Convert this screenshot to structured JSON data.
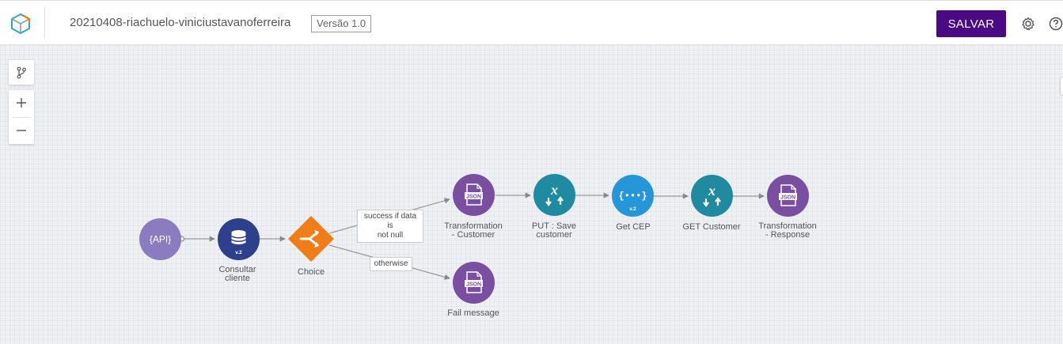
{
  "header": {
    "flow_name": "20210408-riachuelo-viniciustavanoferreira",
    "version": "Versão 1.0",
    "save_label": "SALVAR"
  },
  "icons": {
    "logo": "cube-logo-icon",
    "settings": "gear-icon",
    "help": "help-circle-icon",
    "branch": "branch-icon",
    "zoom_in": "plus-icon",
    "zoom_out": "minus-icon"
  },
  "colors": {
    "primary": "#4a0a84",
    "api_node": "#8b7bbf",
    "database_node": "#2e3f8c",
    "choice_node": "#f07d18",
    "json_node": "#7a4ea0",
    "mapper_node": "#1f8aa0",
    "rest_node": "#2596d8"
  },
  "nodes": {
    "api": {
      "label": "",
      "icon_text": "{API}"
    },
    "consultar": {
      "label": "Consultar\ncliente",
      "badge": "v.2"
    },
    "choice": {
      "label": "Choice"
    },
    "transform_customer": {
      "label": "Transformation\n- Customer",
      "icon_text": "JSON"
    },
    "put_save": {
      "label": "PUT : Save\ncustomer"
    },
    "get_cep": {
      "label": "Get CEP",
      "badge": "v.2"
    },
    "get_customer": {
      "label": "GET Customer"
    },
    "transform_response": {
      "label": "Transformation\n- Response",
      "icon_text": "JSON"
    },
    "fail_message": {
      "label": "Fail message",
      "icon_text": "JSON"
    }
  },
  "edges": {
    "success": "success if data is\nnot null",
    "otherwise": "otherwise"
  }
}
